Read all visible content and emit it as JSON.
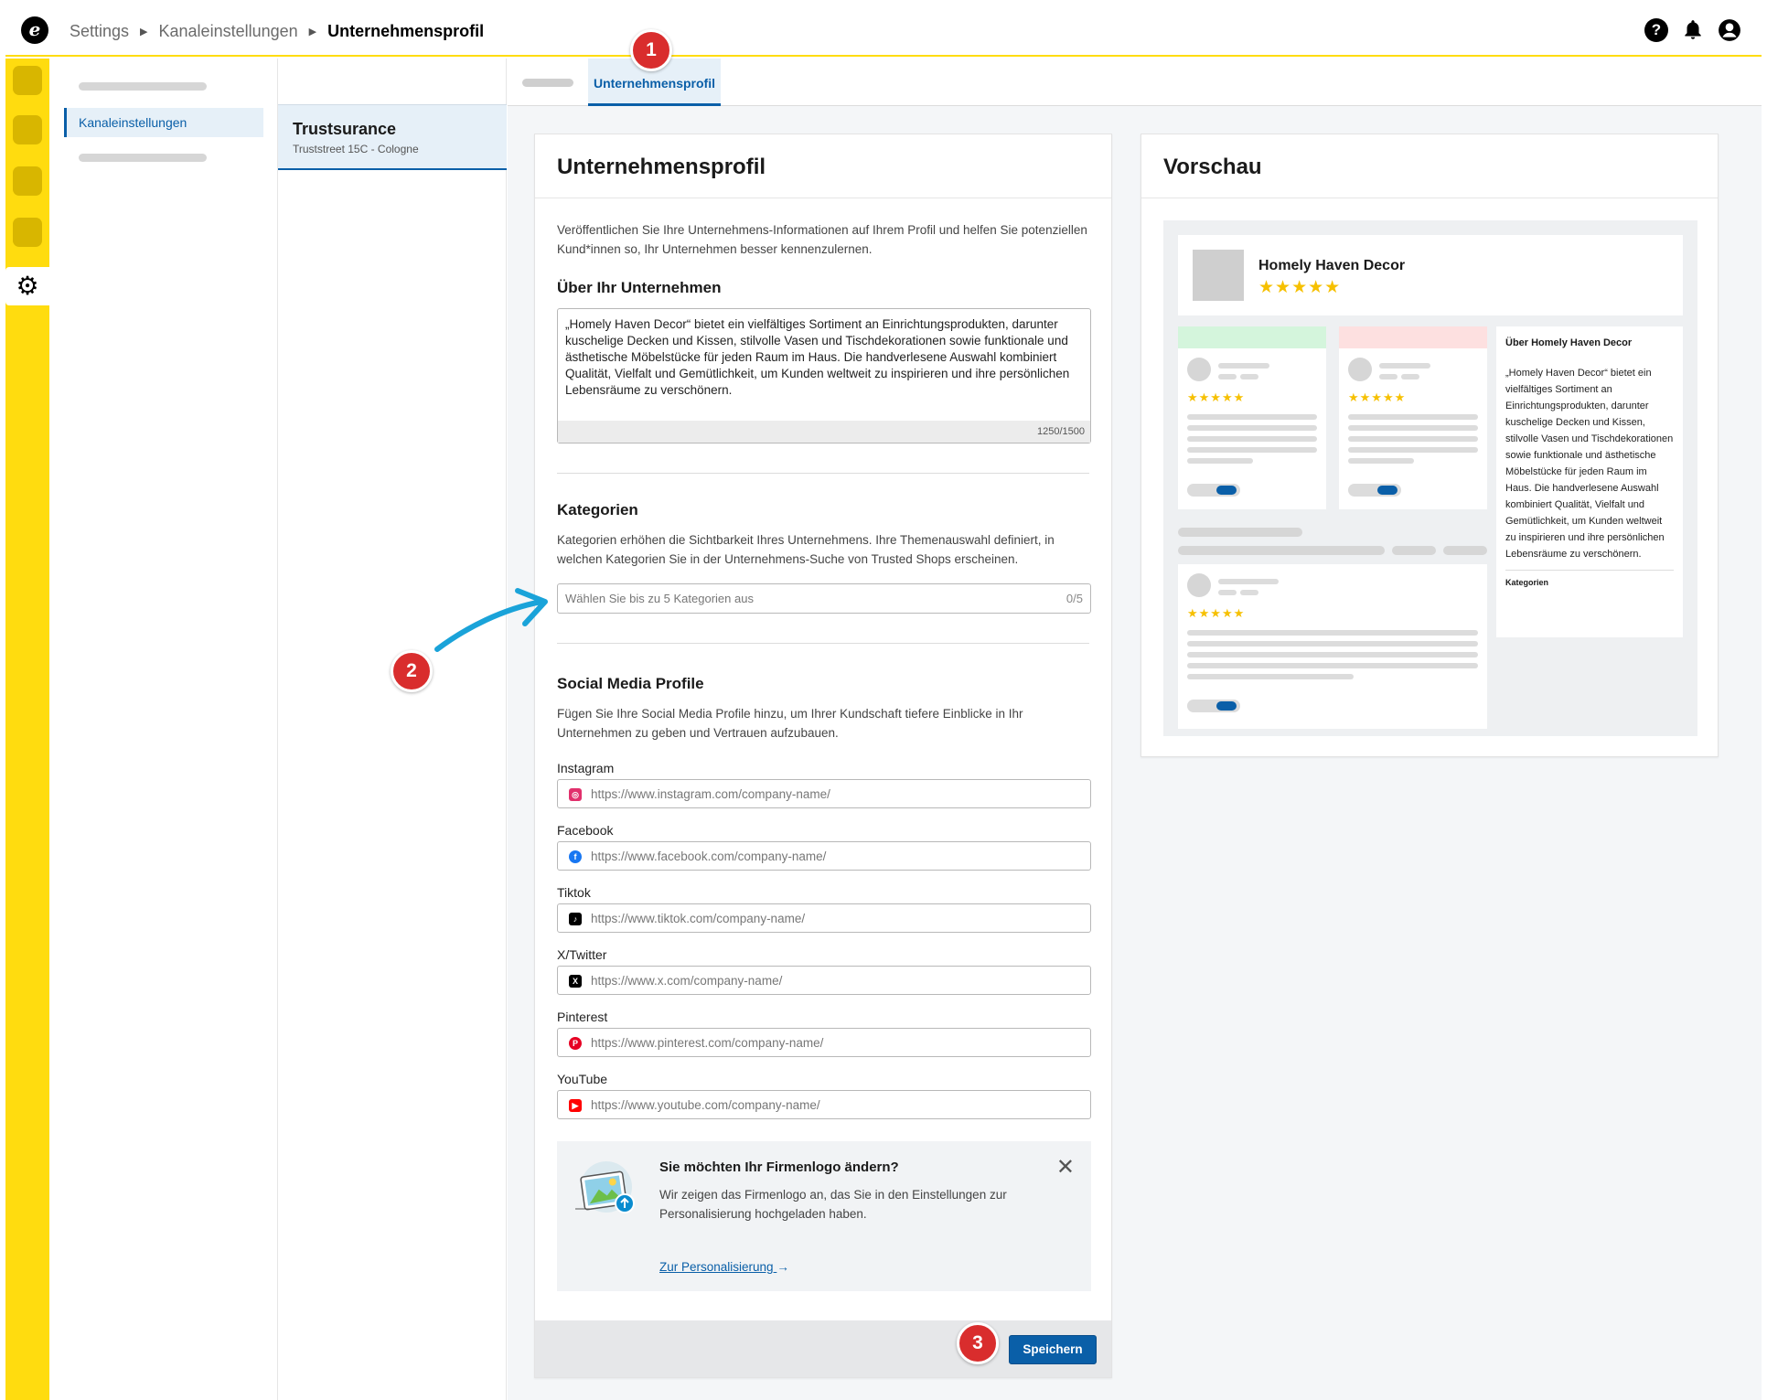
{
  "breadcrumb": {
    "root": "Settings",
    "middle": "Kanaleinstellungen",
    "current": "Unternehmensprofil"
  },
  "topbar": {
    "help_icon": "help-icon",
    "bell_icon": "bell-icon",
    "user_icon": "user-icon"
  },
  "rail": {
    "items": [
      "app-1",
      "app-2",
      "app-3",
      "app-4"
    ],
    "settings_icon": "gear-icon"
  },
  "nav": {
    "active_label": "Kanaleinstellungen"
  },
  "channel": {
    "name": "Trustsurance",
    "address": "Truststreet 15C - Cologne"
  },
  "tabs": {
    "active_label": "Unternehmensprofil"
  },
  "form": {
    "title": "Unternehmensprofil",
    "intro": "Veröffentlichen Sie Ihre Unternehmens-Informationen auf Ihrem Profil und helfen Sie potenziellen Kund*innen so, Ihr Unternehmen besser kennenzulernen.",
    "about_heading": "Über Ihr Unternehmen",
    "about_text": "„Homely Haven Decor“ bietet ein vielfältiges Sortiment an Einrichtungsprodukten, darunter kuschelige Decken und Kissen, stilvolle Vasen und Tischdekorationen sowie funktionale und ästhetische Möbelstücke für jeden Raum im Haus. Die handverlesene Auswahl kombiniert Qualität, Vielfalt und Gemütlichkeit, um Kunden weltweit zu inspirieren und ihre persönlichen Lebensräume zu verschönern.",
    "about_counter": "1250/1500",
    "categories_heading": "Kategorien",
    "categories_text": "Kategorien erhöhen die Sichtbarkeit Ihres Unternehmens. Ihre Themenauswahl definiert, in welchen Kategorien Sie in der Unternehmens-Suche von Trusted Shops erscheinen.",
    "categories_placeholder": "Wählen Sie bis zu 5 Kategorien aus",
    "categories_counter": "0/5",
    "social_heading": "Social Media Profile",
    "social_text": "Fügen Sie Ihre Social Media Profile hinzu, um Ihrer Kundschaft tiefere Einblicke in Ihr Unternehmen zu geben und Vertrauen aufzubauen.",
    "social": [
      {
        "label": "Instagram",
        "placeholder": "https://www.instagram.com/company-name/",
        "icon": "instagram-icon",
        "color": "#e1306c"
      },
      {
        "label": "Facebook",
        "placeholder": "https://www.facebook.com/company-name/",
        "icon": "facebook-icon",
        "color": "#1877f2"
      },
      {
        "label": "Tiktok",
        "placeholder": "https://www.tiktok.com/company-name/",
        "icon": "tiktok-icon",
        "color": "#000000"
      },
      {
        "label": "X/Twitter",
        "placeholder": "https://www.x.com/company-name/",
        "icon": "x-icon",
        "color": "#000000"
      },
      {
        "label": "Pinterest",
        "placeholder": "https://www.pinterest.com/company-name/",
        "icon": "pinterest-icon",
        "color": "#e60023"
      },
      {
        "label": "YouTube",
        "placeholder": "https://www.youtube.com/company-name/",
        "icon": "youtube-icon",
        "color": "#ff0000"
      }
    ],
    "logo_info": {
      "title": "Sie möchten Ihr Firmenlogo ändern?",
      "text": "Wir zeigen das Firmenlogo an, das Sie in den Einstellungen zur Personalisierung hochgeladen haben.",
      "link": "Zur Personalisierung"
    },
    "save_label": "Speichern"
  },
  "preview": {
    "title": "Vorschau",
    "shop_name": "Homely Haven Decor",
    "stars": "★★★★★",
    "mini_stars": "★★★★★",
    "about_title": "Über Homely Haven Decor",
    "about_text": "„Homely Haven Decor“ bietet ein vielfältiges Sortiment an Einrichtungsprodukten, darunter kuschelige Decken und Kissen, stilvolle Vasen und Tischdekorationen sowie funktionale und ästhetische Möbelstücke für jeden Raum im Haus. Die handverlesene Auswahl kombiniert Qualität, Vielfalt und Gemütlichkeit, um Kunden weltweit zu inspirieren und ihre persönlichen Lebensräume zu verschönern.",
    "categories_label": "Kategorien"
  },
  "annotations": [
    "1",
    "2",
    "3"
  ],
  "colors": {
    "accent": "#0a5fa8",
    "rail": "#ffdc0f",
    "badge": "#d92d2d",
    "arrow": "#1aa3d9"
  }
}
